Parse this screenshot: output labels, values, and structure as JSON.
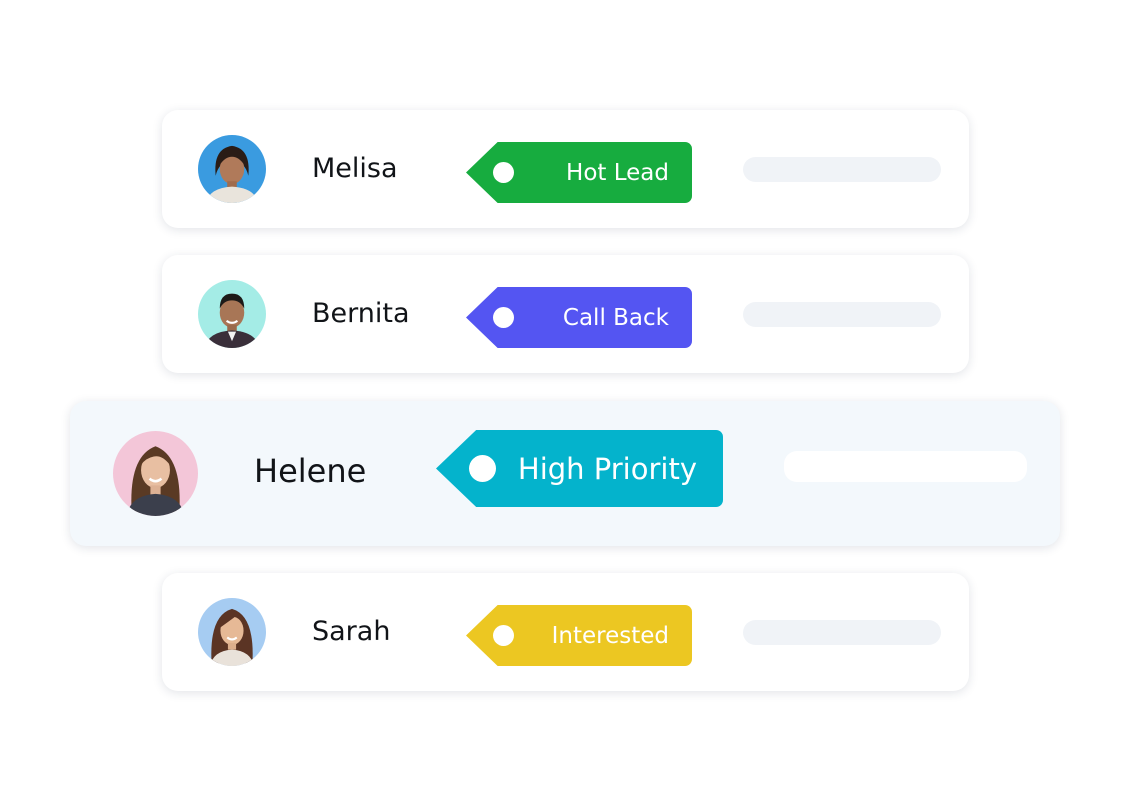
{
  "contacts": [
    {
      "name": "Melisa",
      "tag": "Hot Lead",
      "tag_color": "#17ac3f",
      "avatar_bg": "#3a9be0",
      "avatar_icon": "person-avatar"
    },
    {
      "name": "Bernita",
      "tag": "Call Back",
      "tag_color": "#5455f2",
      "avatar_bg": "#a4ece6",
      "avatar_icon": "person-avatar"
    },
    {
      "name": "Helene",
      "tag": "High Priority",
      "tag_color": "#04b3cc",
      "avatar_bg": "#f3c6d8",
      "avatar_icon": "person-avatar",
      "highlighted": true
    },
    {
      "name": "Sarah",
      "tag": "Interested",
      "tag_color": "#ecc722",
      "avatar_bg": "#a6ccf2",
      "avatar_icon": "person-avatar"
    }
  ]
}
